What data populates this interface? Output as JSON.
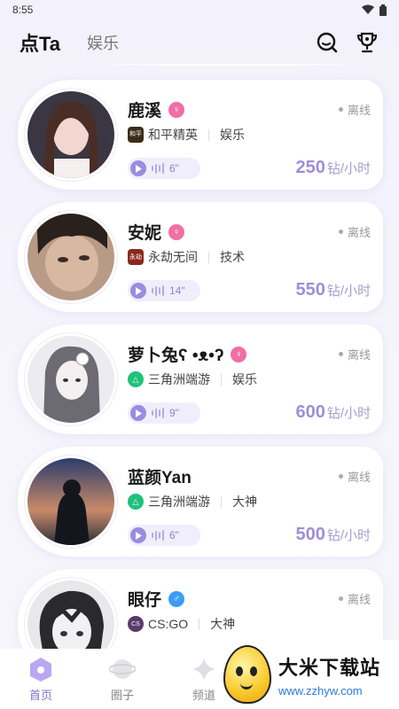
{
  "status_bar": {
    "time": "8:55"
  },
  "header": {
    "tab_active": "点Ta",
    "tab_other": "娱乐"
  },
  "cards": [
    {
      "name": "鹿溪",
      "gender": "female",
      "status": "离线",
      "game": "和平精英",
      "game_icon_text": "和平精英",
      "game_icon_color": "#3a2d1a",
      "category": "娱乐",
      "voice_duration": "6\"",
      "price": "250",
      "price_unit": "钻/小时"
    },
    {
      "name": "安妮",
      "gender": "female",
      "status": "离线",
      "game": "永劫无间",
      "game_icon_text": "永劫",
      "game_icon_color": "#8b2a1f",
      "category": "技术",
      "voice_duration": "14\"",
      "price": "550",
      "price_unit": "钻/小时"
    },
    {
      "name": "萝卜兔ʕ •ᴥ•ʔ",
      "gender": "female",
      "status": "离线",
      "game": "三角洲端游",
      "game_icon_text": "△",
      "game_icon_color": "#1ec27a",
      "category": "娱乐",
      "voice_duration": "9\"",
      "price": "600",
      "price_unit": "钻/小时"
    },
    {
      "name": "蓝颜Yan",
      "gender": "none",
      "status": "离线",
      "game": "三角洲端游",
      "game_icon_text": "△",
      "game_icon_color": "#1ec27a",
      "category": "大神",
      "voice_duration": "6\"",
      "price": "500",
      "price_unit": "钻/小时"
    },
    {
      "name": "眼仔",
      "gender": "male",
      "status": "离线",
      "game": "CS:GO",
      "game_icon_text": "CS",
      "game_icon_color": "#5a3a6a",
      "category": "大神",
      "voice_duration": "",
      "price": "",
      "price_unit": ""
    }
  ],
  "bottom_nav": [
    {
      "label": "首页",
      "active": true
    },
    {
      "label": "圈子",
      "active": false
    },
    {
      "label": "频道",
      "active": false
    }
  ],
  "watermark": {
    "title": "大米下载站",
    "url": "www.zzhyw.com"
  },
  "colors": {
    "accent": "#9d8fd9",
    "female": "#f06fa4",
    "male": "#3b9df5"
  }
}
